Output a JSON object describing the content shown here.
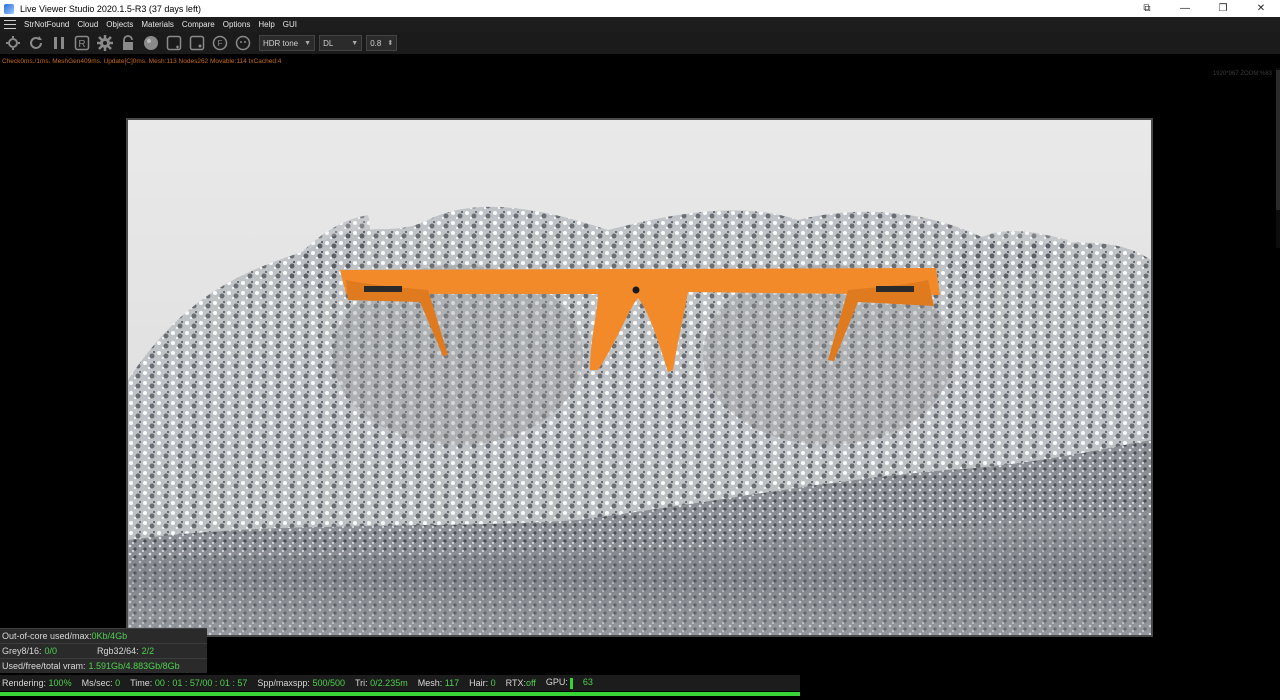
{
  "window": {
    "title": "Live Viewer Studio 2020.1.5-R3 (37 days left)",
    "controls": [
      "⧉",
      "—",
      "❐",
      "✕"
    ]
  },
  "menu": {
    "items": [
      "StrNotFound",
      "Cloud",
      "Objects",
      "Materials",
      "Compare",
      "Options",
      "Help",
      "GUI"
    ]
  },
  "toolbar": {
    "icons": [
      "gear-icon",
      "refresh-icon",
      "pause-icon",
      "render-region-icon",
      "settings-icon",
      "lock-icon",
      "sphere-icon",
      "add-object-icon",
      "add-light-icon",
      "focus-icon",
      "face-icon"
    ],
    "tone_select": "HDR tone",
    "kernel_select": "DL",
    "value_select": "0.8"
  },
  "stats_line": "Check0ms./1ms. MeshGen409ms. Update[C]0ms. Mesh:113 Nodes262 Movable:114 txCached:4",
  "zoom_info": "1920*967 ZOOM:%83",
  "info_panel": {
    "out_of_core_label": "Out-of-core used/max:",
    "out_of_core_value": "0Kb/4Gb",
    "grey_label": "Grey8/16:",
    "grey_value": "0/0",
    "rgb_label": "Rgb32/64:",
    "rgb_value": "2/2",
    "vram_label": "Used/free/total vram:",
    "vram_value": "1.591Gb/4.883Gb/8Gb"
  },
  "status_bar": {
    "rendering_label": "Rendering:",
    "rendering_value": "100%",
    "ms_label": "Ms/sec:",
    "ms_value": "0",
    "time_label": "Time:",
    "time_value": "00 : 01 : 57/00 : 01 : 57",
    "spp_label": "Spp/maxspp:",
    "spp_value": "500/500",
    "tri_label": "Tri:",
    "tri_value": "0/2.235m",
    "mesh_label": "Mesh:",
    "mesh_value": "117",
    "hair_label": "Hair:",
    "hair_value": "0",
    "rtx_label": "RTX:",
    "rtx_value": "off",
    "gpu_label": "GPU:",
    "gpu_value": "63",
    "progress": 1.0
  },
  "colors": {
    "accent_green": "#4fd14f",
    "stats_orange": "#c46a1a",
    "frame_orange": "#f28a2a"
  }
}
